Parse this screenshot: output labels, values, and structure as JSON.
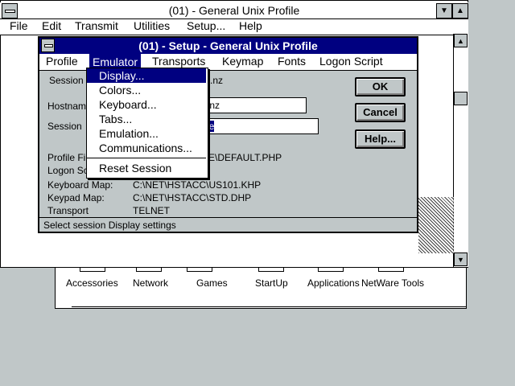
{
  "program_group": {
    "icons": [
      "Accessories",
      "Network",
      "Games",
      "StartUp",
      "Applications",
      "NetWare Tools"
    ]
  },
  "main_window": {
    "title": "(01) - General Unix Profile",
    "menu": [
      "File",
      "Edit",
      "Transmit",
      "Utilities",
      "Setup...",
      "Help"
    ]
  },
  "setup_dialog": {
    "title": "(01) - Setup - General Unix Profile",
    "menu": [
      "Profile",
      "Emulator",
      "Transports",
      "Keymap",
      "Fonts",
      "Logon Script"
    ],
    "fields": {
      "session_label": "Session",
      "session_value_tail": ".nz",
      "hostname_label": "Hostnam",
      "hostname_value_tail": ".nz",
      "session_name_label": "Session",
      "session_name_value_tail": "le"
    },
    "info": [
      {
        "label": "Profile Fi",
        "value": "E\\DEFAULT.PHP"
      },
      {
        "label": "Logon Sc",
        "value": ""
      },
      {
        "label": "Keyboard Map:",
        "value": "C:\\NET\\HSTACC\\US101.KHP"
      },
      {
        "label": "Keypad Map:",
        "value": "C:\\NET\\HSTACC\\STD.DHP"
      },
      {
        "label": "Transport",
        "value": "TELNET"
      }
    ],
    "buttons": {
      "ok": "OK",
      "cancel": "Cancel",
      "help": "Help..."
    },
    "status": "Select session Display settings"
  },
  "emulator_menu": {
    "items": [
      "Display...",
      "Colors...",
      "Keyboard...",
      "Tabs...",
      "Emulation...",
      "Communications...",
      "Reset Session"
    ],
    "selected_index": 0
  },
  "colors": {
    "title_bar": "#000080",
    "face": "#c0c7c8"
  }
}
